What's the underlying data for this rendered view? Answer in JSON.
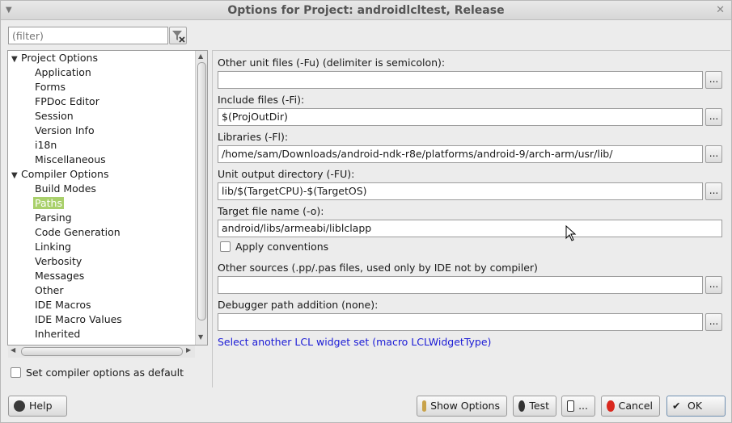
{
  "window": {
    "title": "Options for Project: androidlcltest, Release"
  },
  "filter": {
    "placeholder": "(filter)"
  },
  "tree": {
    "groups": [
      {
        "label": "Project Options",
        "items": [
          "Application",
          "Forms",
          "FPDoc Editor",
          "Session",
          "Version Info",
          "i18n",
          "Miscellaneous"
        ]
      },
      {
        "label": "Compiler Options",
        "items": [
          "Build Modes",
          "Paths",
          "Parsing",
          "Code Generation",
          "Linking",
          "Verbosity",
          "Messages",
          "Other",
          "IDE Macros",
          "IDE Macro Values",
          "Inherited"
        ]
      }
    ],
    "selected": "Paths"
  },
  "set_default_label": "Set compiler options as default",
  "fields": {
    "other_unit_files": {
      "label": "Other unit files (-Fu) (delimiter is semicolon):",
      "value": ""
    },
    "include_files": {
      "label": "Include files (-Fi):",
      "value": "$(ProjOutDir)"
    },
    "libraries": {
      "label": "Libraries (-Fl):",
      "value": "/home/sam/Downloads/android-ndk-r8e/platforms/android-9/arch-arm/usr/lib/"
    },
    "unit_output": {
      "label": "Unit output directory (-FU):",
      "value": "lib/$(TargetCPU)-$(TargetOS)"
    },
    "target_file": {
      "label": "Target file name (-o):",
      "value": "android/libs/armeabi/liblclapp"
    },
    "apply_conventions": {
      "label": "Apply conventions",
      "checked": false
    },
    "other_sources": {
      "label": "Other sources (.pp/.pas files, used only by IDE not by compiler)",
      "value": ""
    },
    "debugger_path": {
      "label": "Debugger path addition (none):",
      "value": ""
    }
  },
  "dots_label": "...",
  "link_text": "Select another LCL widget set (macro LCLWidgetType)",
  "buttons": {
    "help": "Help",
    "show_options": "Show Options",
    "test": "Test",
    "export": "...",
    "cancel": "Cancel",
    "ok": "OK"
  }
}
